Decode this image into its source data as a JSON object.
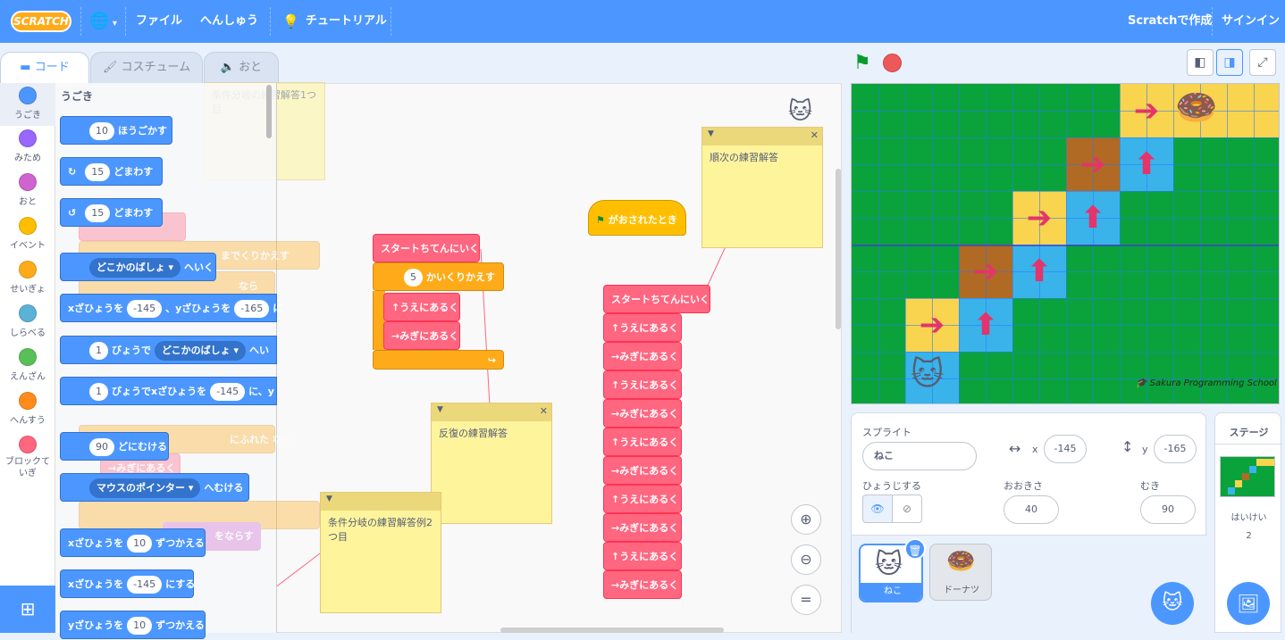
{
  "menubar": {
    "logo": "SCRATCH",
    "file": "ファイル",
    "edit": "へんしゅう",
    "tutorial": "チュートリアル",
    "create": "Scratchで作成",
    "signin": "サインイン"
  },
  "tabs": {
    "code": "コード",
    "costume": "コスチューム",
    "sound": "おと"
  },
  "categories": [
    {
      "label": "うごき",
      "color": "#4c97ff"
    },
    {
      "label": "みため",
      "color": "#9966ff"
    },
    {
      "label": "おと",
      "color": "#cf63cf"
    },
    {
      "label": "イベント",
      "color": "#ffbf00"
    },
    {
      "label": "せいぎょ",
      "color": "#ffab19"
    },
    {
      "label": "しらべる",
      "color": "#5cb1d6"
    },
    {
      "label": "えんざん",
      "color": "#59c059"
    },
    {
      "label": "へんすう",
      "color": "#ff8c1a"
    },
    {
      "label": "ブロックて\nいぎ",
      "color": "#ff6680"
    }
  ],
  "palette": {
    "heading": "うごき",
    "b1": {
      "val": "10",
      "text": "ほうごかす"
    },
    "b2": {
      "val": "15",
      "text": "どまわす"
    },
    "b3": {
      "val": "15",
      "text": "どまわす"
    },
    "b4": {
      "dd": "どこかのばしょ",
      "text": "へいく"
    },
    "b5": {
      "t1": "xざひょうを",
      "v1": "-145",
      "t2": "、yざひょうを",
      "v2": "-165",
      "t3": "に"
    },
    "b6": {
      "val": "1",
      "t1": "びょうで",
      "dd": "どこかのばしょ",
      "t2": "へい"
    },
    "b7": {
      "val": "1",
      "t1": "びょうでxざひょうを",
      "v2": "-145",
      "t2": "に、y"
    },
    "b8": {
      "val": "90",
      "text": "どにむける"
    },
    "b9": {
      "dd": "マウスのポインター",
      "text": "へむける"
    },
    "b10": {
      "t1": "xざひょうを",
      "val": "10",
      "t2": "ずつかえる"
    },
    "b11": {
      "t1": "xざひょうを",
      "val": "-145",
      "t2": "にする"
    },
    "b12": {
      "t1": "yざひょうを",
      "val": "10",
      "t2": "ずつかえる"
    }
  },
  "workspace": {
    "note_top": "条件分岐の練習解答1つ目",
    "note_seq": "順次の練習解答",
    "note_rep": "反復の練習解答",
    "note_cond2": "条件分岐の練習解答例2つ目",
    "flag_block": "がおされたとき",
    "start1": "スタートちてんにいく",
    "repeat_val": "5",
    "repeat_text": "かいくりかえす",
    "up": "↑うえにあるく",
    "right": "→みぎにあるく",
    "start2": "スタートちてんにいく",
    "seq": [
      "↑うえにあるく",
      "→みぎにあるく",
      "↑うえにあるく",
      "→みぎにあるく",
      "↑うえにあるく",
      "→みぎにあるく",
      "↑うえにあるく",
      "→みぎにあるく",
      "↑うえにあるく",
      "→みぎにあるく"
    ],
    "ghost": [
      "までくりかえす",
      "なら",
      "なら",
      "にふれた",
      "→みぎにあるく",
      "をならす"
    ]
  },
  "stage": {
    "watermark": "Sakura Programming School"
  },
  "sprite_info": {
    "sprite_label": "スプライト",
    "name": "ねこ",
    "x_label": "x",
    "x": "-145",
    "y_label": "y",
    "y": "-165",
    "show_label": "ひょうじする",
    "size_label": "おおきさ",
    "size": "40",
    "dir_label": "むき",
    "direction": "90"
  },
  "sprites": [
    {
      "name": "ねこ",
      "selected": true
    },
    {
      "name": "ドーナツ",
      "selected": false
    }
  ],
  "stage_panel": {
    "title": "ステージ",
    "backdrop_label": "はいけい",
    "backdrop_count": "2"
  }
}
